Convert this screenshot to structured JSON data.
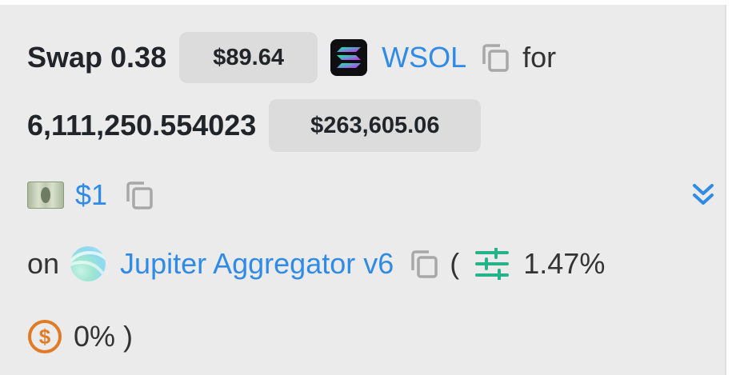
{
  "swap": {
    "verb": "Swap",
    "amount_in": "0.38",
    "amount_in_usd": "$89.64",
    "token_in": {
      "symbol": "WSOL",
      "icon": "solana-icon"
    },
    "for_word": "for",
    "amount_out": "6,111,250.554023",
    "amount_out_usd": "$263,605.06",
    "token_out": {
      "symbol": "$1",
      "icon": "dollar-bill-icon"
    },
    "on_word": "on",
    "dex": {
      "name": "Jupiter Aggregator v6",
      "icon": "jupiter-icon"
    },
    "open_paren": "(",
    "slippage": "1.47%",
    "fee": "0%",
    "close_paren": ")"
  },
  "colors": {
    "link": "#2f8be6",
    "card_bg": "#ebebeb",
    "badge_bg": "#dcdcdc",
    "slippage_icon": "#26b38a",
    "fee_icon": "#e07b26"
  }
}
